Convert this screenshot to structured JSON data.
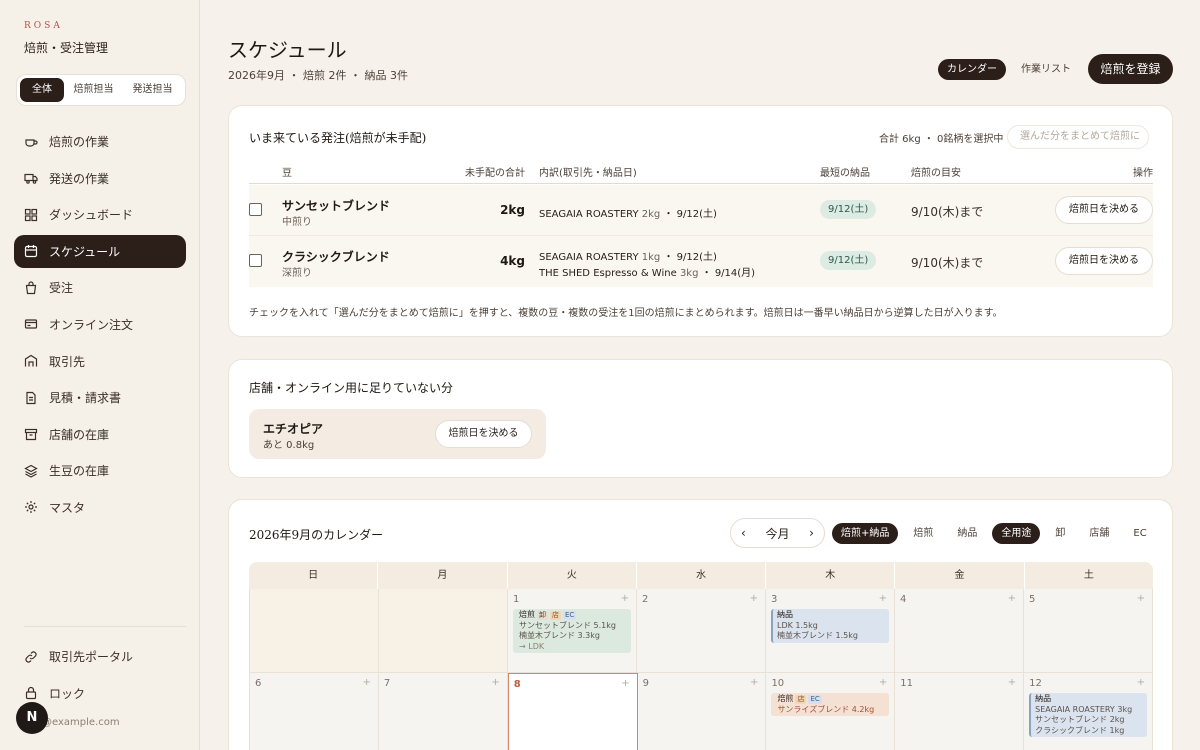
{
  "sidebar": {
    "brand_small": "ROSA",
    "brand_title": "焙煎・受注管理",
    "segments": [
      "全体",
      "焙煎担当",
      "発送担当"
    ],
    "items": [
      {
        "label": "焙煎の作業",
        "icon": "roast-cup-icon"
      },
      {
        "label": "発送の作業",
        "icon": "truck-icon"
      },
      {
        "label": "ダッシュボード",
        "icon": "dashboard-icon"
      },
      {
        "label": "スケジュール",
        "icon": "calendar-icon",
        "active": true
      },
      {
        "label": "受注",
        "icon": "bag-icon"
      },
      {
        "label": "オンライン注文",
        "icon": "card-icon"
      },
      {
        "label": "取引先",
        "icon": "building-icon"
      },
      {
        "label": "見積・請求書",
        "icon": "document-icon"
      },
      {
        "label": "店舗の在庫",
        "icon": "box-icon"
      },
      {
        "label": "生豆の在庫",
        "icon": "layers-icon"
      },
      {
        "label": "マスタ",
        "icon": "gear-icon"
      }
    ],
    "bottom_items": [
      {
        "label": "取引先ポータル",
        "icon": "link-icon"
      },
      {
        "label": "ロック",
        "icon": "lock-icon"
      }
    ],
    "avatar": "N",
    "email": "@example.com"
  },
  "header": {
    "title": "スケジュール",
    "subtitle": "2026年9月 ・ 焙煎 2件 ・ 納品 3件",
    "views": [
      "カレンダー",
      "作業リスト"
    ],
    "primary": "焙煎を登録"
  },
  "orders": {
    "title": "いま来ている発注(焙煎が未手配)",
    "summary": "合計 6kg ・ 0銘柄を選択中",
    "batch_button": "選んだ分をまとめて焙煎に",
    "columns": [
      "豆",
      "未手配の合計",
      "内訳(取引先・納品日)",
      "最短の納品",
      "焙煎の目安",
      "操作"
    ],
    "rows": [
      {
        "name": "サンセットブレンド",
        "roast": "中煎り",
        "total": "2kg",
        "lines": [
          {
            "client": "SEAGAIA ROASTERY",
            "qty": "2kg",
            "date": "・ 9/12(土)"
          }
        ],
        "earliest": "9/12(土)",
        "target": "9/10(木)まで",
        "action": "焙煎日を決める"
      },
      {
        "name": "クラシックブレンド",
        "roast": "深煎り",
        "total": "4kg",
        "lines": [
          {
            "client": "SEAGAIA ROASTERY",
            "qty": "1kg",
            "date": "・ 9/12(土)"
          },
          {
            "client": "THE SHED Espresso & Wine",
            "qty": "3kg",
            "date": "・ 9/14(月)"
          }
        ],
        "earliest": "9/12(土)",
        "target": "9/10(木)まで",
        "action": "焙煎日を決める"
      }
    ],
    "note": "チェックを入れて「選んだ分をまとめて焙煎に」を押すと、複数の豆・複数の受注を1回の焙煎にまとめられます。焙煎日は一番早い納品日から逆算した日が入ります。"
  },
  "shortage": {
    "title": "店舗・オンライン用に足りていない分",
    "name": "エチオピア",
    "amount": "あと 0.8kg",
    "action": "焙煎日を決める"
  },
  "calendar": {
    "title": "2026年9月のカレンダー",
    "prev": "‹",
    "today": "今月",
    "next": "›",
    "type_filters": [
      "焙煎+納品",
      "焙煎",
      "納品"
    ],
    "channel_filters": [
      "全用途",
      "卸",
      "店舗",
      "EC"
    ],
    "weekdays": [
      "日",
      "月",
      "火",
      "水",
      "木",
      "金",
      "土"
    ],
    "plus": "+",
    "days": {
      "d1": "1",
      "d2": "2",
      "d3": "3",
      "d4": "4",
      "d5": "5",
      "d6": "6",
      "d7": "7",
      "d8": "8",
      "d9": "9",
      "d10": "10",
      "d11": "11",
      "d12": "12"
    },
    "events": {
      "e1": {
        "kind": "焙煎",
        "tags": [
          "卸",
          "店",
          "EC"
        ],
        "lines": [
          "サンセットブレンド 5.1kg",
          "楠並木ブレンド 3.3kg"
        ],
        "arrow": "→ LDK"
      },
      "e3": {
        "kind": "納品",
        "lines": [
          "LDK 1.5kg",
          "楠並木ブレンド 1.5kg"
        ]
      },
      "e10": {
        "kind": "焙煎",
        "tags": [
          "店",
          "EC"
        ],
        "lines": [
          "サンライズブレンド 4.2kg"
        ]
      },
      "e12": {
        "kind": "納品",
        "lines": [
          "SEAGAIA ROASTERY 3kg",
          "サンセットブレンド 2kg",
          "クラシックブレンド 1kg"
        ]
      }
    }
  }
}
